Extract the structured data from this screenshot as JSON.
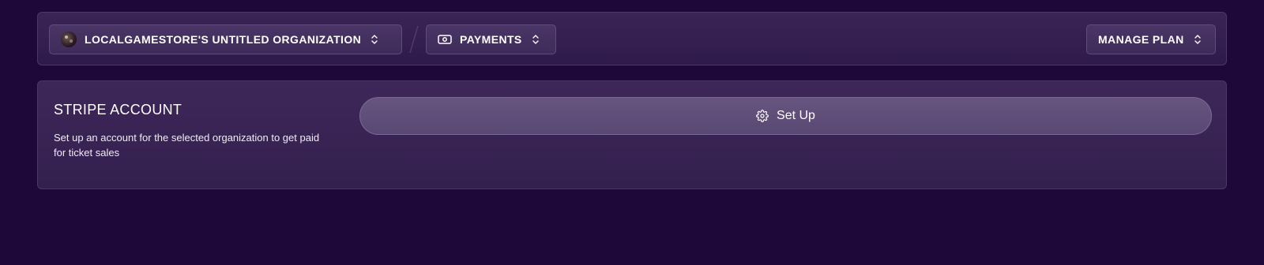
{
  "topbar": {
    "organization": {
      "label": "LOCALGAMESTORE'S UNTITLED ORGANIZATION",
      "icon": "avatar"
    },
    "section": {
      "label": "PAYMENTS",
      "icon": "cash-icon"
    },
    "plan": {
      "label": "MANAGE PLAN"
    }
  },
  "stripe": {
    "title": "STRIPE ACCOUNT",
    "description": "Set up an account for the selected organization to get paid for ticket sales",
    "setup_label": "Set Up",
    "setup_icon": "gear-icon"
  },
  "colors": {
    "background": "#1e0839",
    "panel": "#35214f",
    "button": "#5e4c78"
  }
}
